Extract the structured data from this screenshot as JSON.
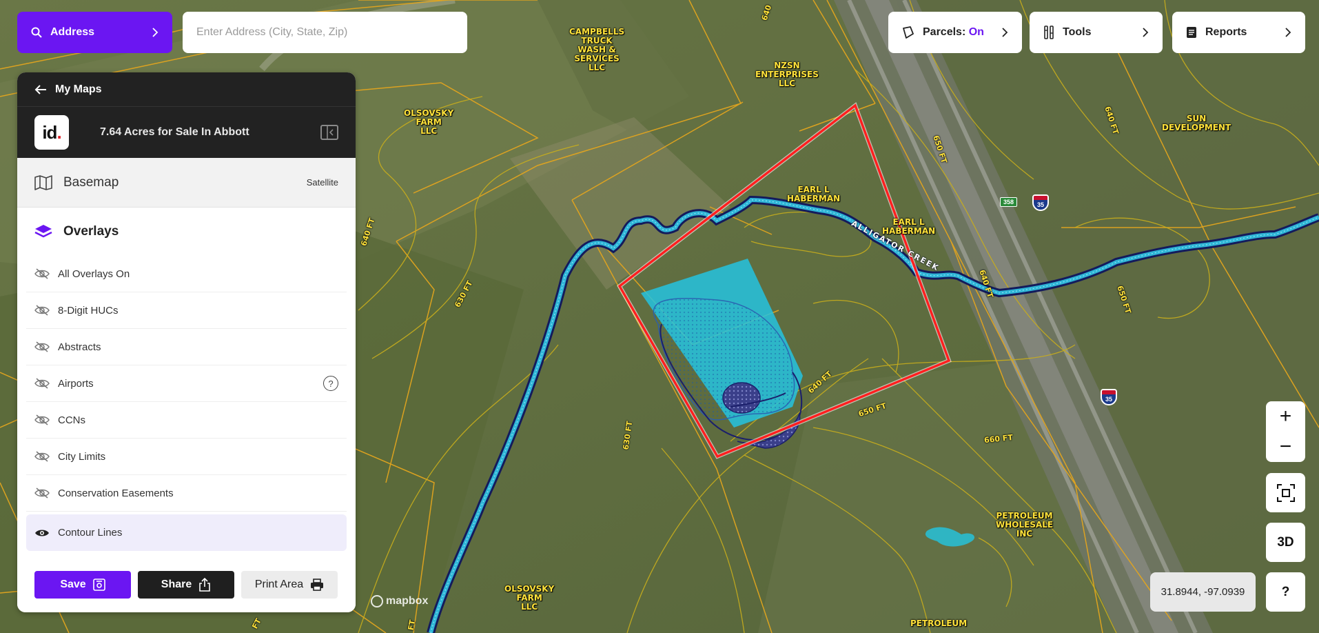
{
  "search": {
    "mode_label": "Address",
    "placeholder": "Enter Address (City, State, Zip)"
  },
  "toolbar": {
    "parcels_label": "Parcels:",
    "parcels_state": "On",
    "tools_label": "Tools",
    "reports_label": "Reports"
  },
  "panel": {
    "back_label": "My Maps",
    "logo_text": "id",
    "map_title": "7.64 Acres for Sale In Abbott",
    "basemap_label": "Basemap",
    "basemap_value": "Satellite",
    "overlays_label": "Overlays",
    "overlay_items": [
      {
        "label": "All Overlays On",
        "visible": false
      },
      {
        "label": "8-Digit HUCs",
        "visible": false
      },
      {
        "label": "Abstracts",
        "visible": false
      },
      {
        "label": "Airports",
        "visible": false
      },
      {
        "label": "CCNs",
        "visible": false
      },
      {
        "label": "City Limits",
        "visible": false
      },
      {
        "label": "Conservation Easements",
        "visible": false
      },
      {
        "label": "Contour Lines",
        "visible": true
      }
    ],
    "help_glyph": "?",
    "save_label": "Save",
    "share_label": "Share",
    "print_label": "Print Area"
  },
  "map": {
    "owner_labels": [
      "CAMPBELLS\nTRUCK\nWASH &\nSERVICES\nLLC",
      "NZSN\nENTERPRISES\nLLC",
      "OLSOVSKY\nFARM\nLLC",
      "SUN\nDEVELOPMENT",
      "EARL L\nHABERMAN",
      "EARL L\nHABERMAN",
      "PETROLEUM\nWHOLESALE\nINC",
      "OLSOVSKY\nFARM\nLLC",
      "PETROLEUM"
    ],
    "contour_labels": [
      "640 FT",
      "650 FT",
      "660 FT",
      "630 FT",
      "630 FT",
      "640 FT",
      "640 FT",
      "650 FT",
      "650 FT",
      "640 FT",
      "630 FT",
      "FT",
      "640"
    ],
    "creek_label": "ALLIGATOR CREEK",
    "highway_shields": [
      "358",
      "35",
      "35"
    ],
    "attribution": "mapbox",
    "colors": {
      "parcel_line": "#e3a51e",
      "contour_line": "#c9ae1c",
      "selected_parcel": "#ff2020",
      "flood_zone": "#25c3e0",
      "creek_outline": "#1b1f6b",
      "creek_fill": "#2fb5d6",
      "accent": "#6b16f2"
    }
  },
  "controls": {
    "zoom_in": "+",
    "zoom_out": "−",
    "three_d_label": "3D",
    "help_label": "?",
    "coordinates": "31.8944, -97.0939"
  }
}
